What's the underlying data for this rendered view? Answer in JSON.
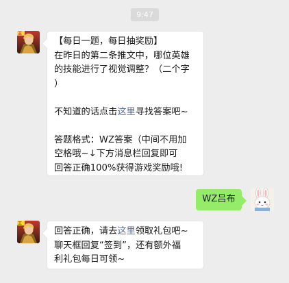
{
  "timestamp": "9:47",
  "colors": {
    "background": "#ededed",
    "incoming_bubble": "#ffffff",
    "outgoing_bubble": "#95ec69",
    "link": "#576b95",
    "text": "#191919"
  },
  "messages": [
    {
      "sender": "official-account",
      "avatar_icon": "hero-game-avatar-icon",
      "title": "【每日一题，每日抽奖励】",
      "question_line1": "在昨日的第二条推文中，哪位英雄",
      "question_line2": "的技能进行了视觉调整？（二个字",
      "question_line3": "）",
      "hint_prefix": "不知道的话点击",
      "hint_link": "这里",
      "hint_suffix": "寻找答案吧~",
      "format_line1": "答题格式：WZ答案（中间不用加",
      "format_line2": "空格哦~↓下方消息栏回复即可",
      "format_line3": "回答正确100%获得游戏奖励哦!"
    },
    {
      "sender": "user",
      "avatar_icon": "bunny-cartoon-avatar-icon",
      "text": "WZ吕布"
    },
    {
      "sender": "official-account",
      "avatar_icon": "hero-game-avatar-icon",
      "reply_prefix": "回答正确，请去",
      "reply_link": "这里",
      "reply_suffix": "领取礼包吧~",
      "reply_line2": "聊天框回复“签到”，还有额外福",
      "reply_line3": "利礼包每日可领~"
    }
  ]
}
